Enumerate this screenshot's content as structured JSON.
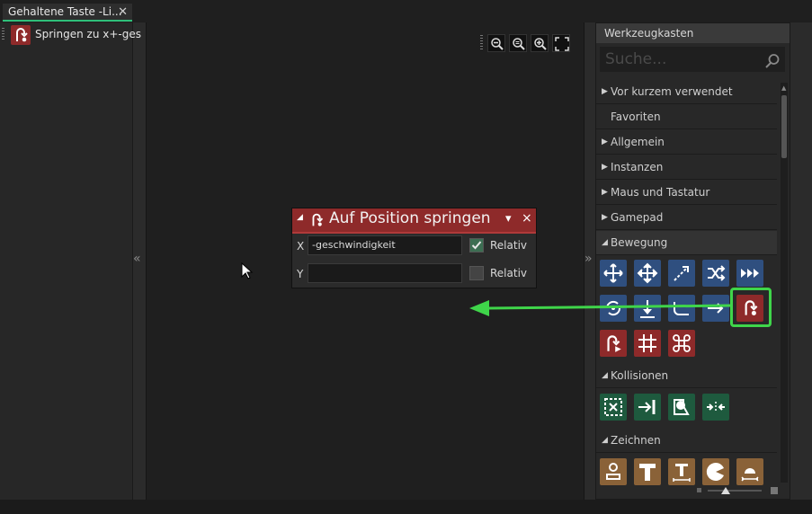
{
  "tab": {
    "label": "Gehaltene Taste -Li...",
    "close": "✕"
  },
  "left_list": {
    "item_label": "Springen zu x+-ges"
  },
  "canvas": {
    "collapse_left": "«",
    "collapse_right": "»"
  },
  "action": {
    "title": "Auf Position springen",
    "menu_arrow": "▾",
    "close": "×",
    "fields": [
      {
        "label": "X",
        "value": "-geschwindigkeit",
        "relative_label": "Relativ",
        "relative_checked": true
      },
      {
        "label": "Y",
        "value": "",
        "relative_label": "Relativ",
        "relative_checked": false
      }
    ]
  },
  "toolbox": {
    "title": "Werkzeugkasten",
    "search_placeholder": "Suche...",
    "categories": [
      {
        "label": "Vor kurzem verwendet",
        "arrow": "▶"
      },
      {
        "label": "Favoriten",
        "arrow": ""
      },
      {
        "label": "Allgemein",
        "arrow": "▶"
      },
      {
        "label": "Instanzen",
        "arrow": "▶"
      },
      {
        "label": "Maus und Tastatur",
        "arrow": "▶"
      },
      {
        "label": "Gamepad",
        "arrow": "▶"
      },
      {
        "label": "Bewegung",
        "arrow": "◢"
      },
      {
        "label": "Kollisionen",
        "arrow": "◢"
      },
      {
        "label": "Zeichnen",
        "arrow": "◢"
      }
    ],
    "colors": {
      "movement": "#2f4f7f",
      "jump": "#8e2a2a",
      "collision": "#1e5a3e",
      "draw": "#8a6238",
      "highlight": "#3fd54a"
    }
  }
}
